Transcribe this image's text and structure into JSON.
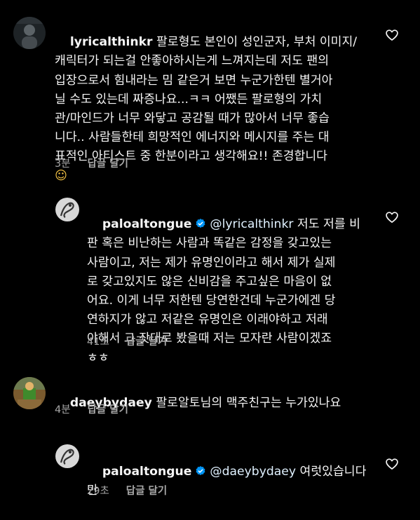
{
  "comments": [
    {
      "username": "lyricalthinkr",
      "text": "팔로형도 본인이 성인군자, 부처 이미지/\n캐릭터가 되는걸 안좋아하시는게 느껴지는데 저도 팬의\n입장으로서 힘내라는 밈 같은거 보면 누군가한텐 별거아\n닐 수도 있는데 짜증나요...ㅋㅋ 어쨌든 팔로형의 가치\n관/마인드가 너무 와닿고 공감될 때가 많아서 너무 좋습\n니다.. 사람들한테 희망적인 에너지와 메시지를 주는 대\n표적인 아티스트 중 한분이라고 생각해요!! 존경합니다",
      "emoji": "☺",
      "time": "3분",
      "reply_label": "답글 달기"
    },
    {
      "username": "paloaltongue",
      "mention": "@lyricalthinkr",
      "text": " 저도 저를 비\n판 혹은 비난하는 사람과 똑같은 감정을 갖고있는\n사람이고, 저는 제가 유명인이라고 해서 제가 실제\n로 갖고있지도 않은 신비감을 주고싶은 마음이 없\n어요. 이게 너무 저한텐 당연한건데 누군가에겐 당\n연하지가 않고 저같은 유명인은 이래야하고 저래\n야해서 그 잣대로 봤을때 저는 모자란 사람이겠죠\nㅎㅎ",
      "time": "41초",
      "reply_label": "답글 달기"
    },
    {
      "username": "daeybydaey",
      "text": " 팔로알토님의 맥주친구는 누가있나요",
      "time": "4분",
      "reply_label": "답글 달기"
    },
    {
      "username": "paloaltongue",
      "mention": "@daeybydaey",
      "text": " 여럿있습니다\n만",
      "time": "29초",
      "reply_label": "답글 달기"
    }
  ],
  "colors": {
    "background": "#000000",
    "text": "#f5f5f5",
    "meta": "#a8a8a8",
    "mention": "#e0f1ff",
    "verified": "#0095f6"
  },
  "icons": {
    "like": "heart-outline-icon",
    "verified": "verified-badge-icon"
  }
}
